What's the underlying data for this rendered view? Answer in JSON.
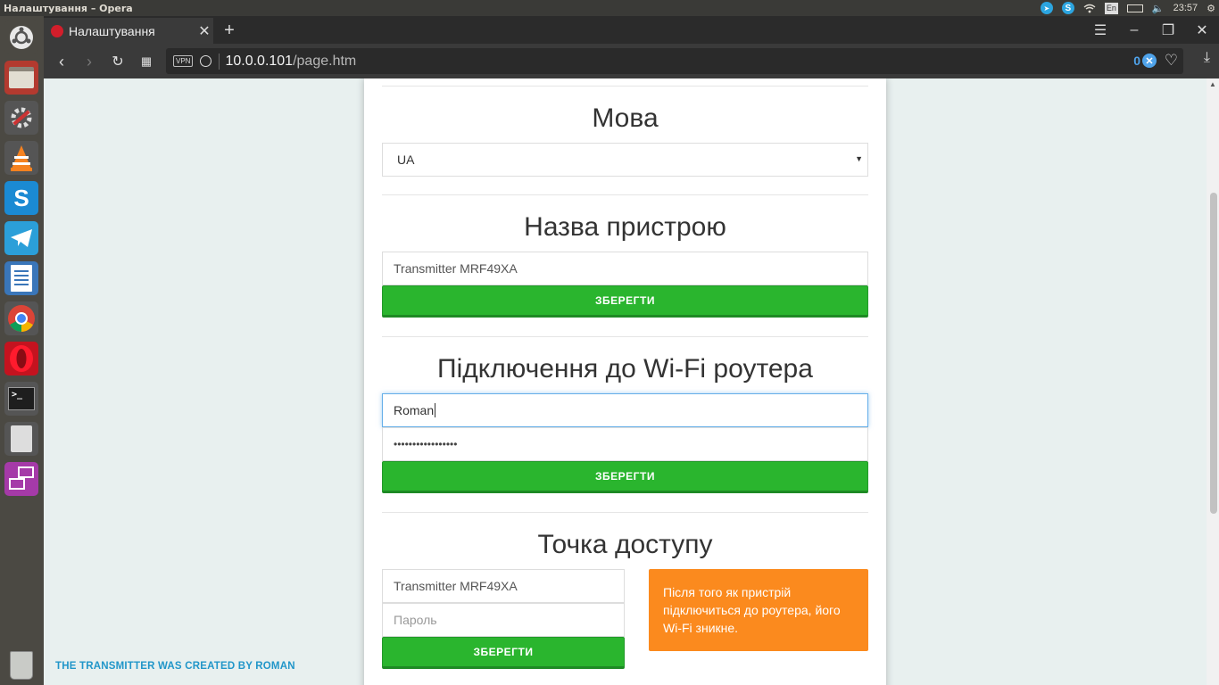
{
  "system": {
    "window_title": "Налаштування – Opera",
    "keyboard_layout": "En",
    "time": "23:57"
  },
  "browser": {
    "tab_title": "Налаштування",
    "vpn_badge": "VPN",
    "url_host": "10.0.0.101",
    "url_path": "/page.htm",
    "blocked_count": "0"
  },
  "page": {
    "language": {
      "heading": "Мова",
      "selected": "UA"
    },
    "device_name": {
      "heading": "Назва пристрою",
      "value": "Transmitter MRF49XA",
      "save_label": "ЗБЕРЕГТИ"
    },
    "wifi": {
      "heading": "Підключення до Wi-Fi роутера",
      "ssid_value": "Roman",
      "password_mask": "•••••••••••••••••",
      "save_label": "ЗБЕРЕГТИ"
    },
    "access_point": {
      "heading": "Точка доступу",
      "ssid_value": "Transmitter MRF49XA",
      "password_placeholder": "Пароль",
      "save_label": "ЗБЕРЕГТИ",
      "note": "Після того як пристрій підключиться до роутера, його Wi-Fi зникне."
    },
    "footer": "THE TRANSMITTER WAS CREATED BY ROMAN"
  },
  "launcher": {
    "items": [
      "ubuntu-dash",
      "file-manager",
      "system-settings",
      "vlc",
      "skype",
      "telegram",
      "libreoffice-writer",
      "chrome",
      "opera",
      "terminal",
      "calculator",
      "remote-desktop",
      "trash"
    ]
  },
  "colors": {
    "accent_green": "#2ab52e",
    "note_orange": "#fb8a1e",
    "footer_blue": "#2196c9"
  }
}
